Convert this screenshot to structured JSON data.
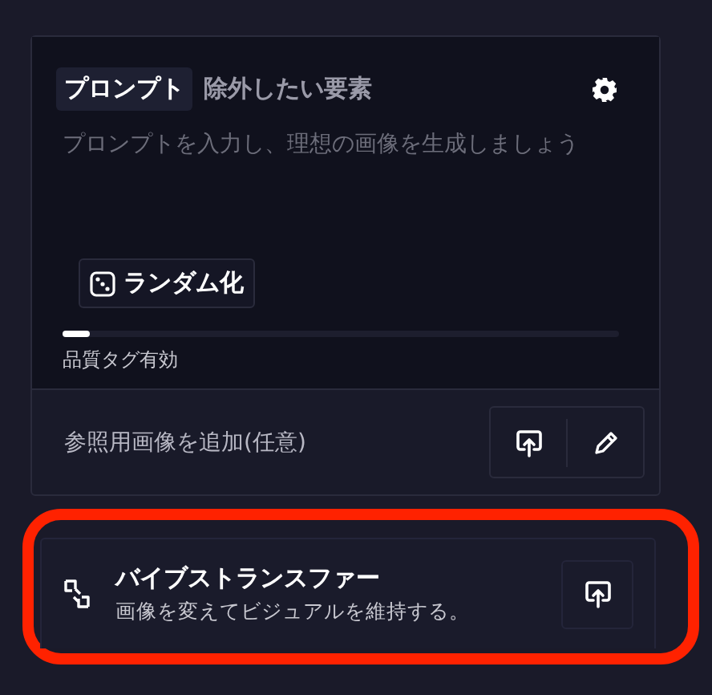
{
  "prompt_panel": {
    "tabs": [
      {
        "label": "プロンプト",
        "selected": true
      },
      {
        "label": "除外したい要素",
        "selected": false
      }
    ],
    "prompt_field": {
      "placeholder": "プロンプトを入力し、理想の画像を生成しましょう"
    },
    "randomize_button": "ランダム化",
    "quality_tags": {
      "level": 0.05,
      "label": "品質タグ有効"
    }
  },
  "reference_image": {
    "label": "参照用画像を追加(任意)"
  },
  "vibe_transfer": {
    "title": "バイブストランスファー",
    "subtitle": "画像を変えてビジュアルを維持する。",
    "highlighted": true
  }
}
